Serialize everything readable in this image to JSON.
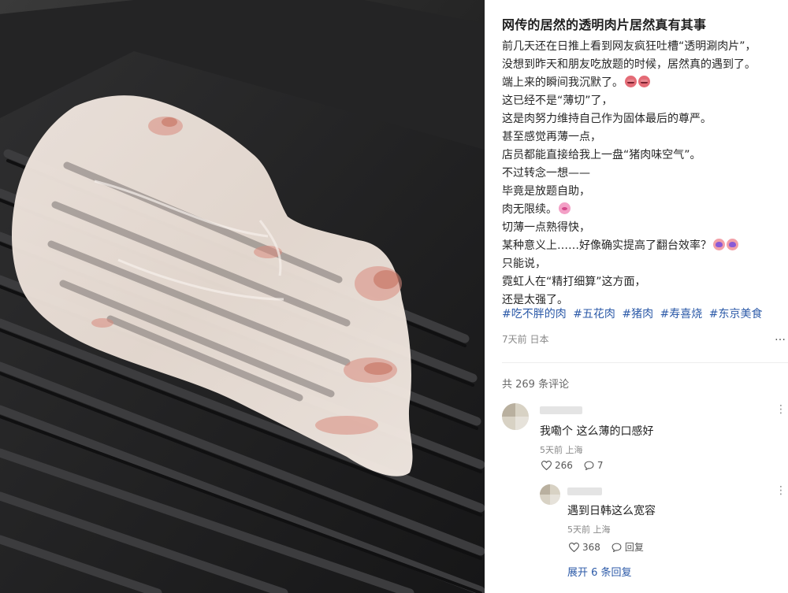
{
  "post": {
    "title": "网传的居然的透明肉片居然真有其事",
    "lines": [
      "前几天还在日推上看到网友疯狂吐槽“透明涮肉片”，",
      "没想到昨天和朋友吃放题的时候，居然真的遇到了。",
      "端上来的瞬间我沉默了。",
      "这已经不是“薄切”了，",
      "这是肉努力维持自己作为固体最后的尊严。",
      "甚至感觉再薄一点，",
      "店员都能直接给我上一盘“猪肉味空气”。",
      "不过转念一想——",
      "毕竟是放题自助，",
      "肉无限续。",
      "切薄一点熟得快，",
      "某种意义上……好像确实提高了翻台效率？",
      "只能说，",
      "霓虹人在“精打细算”这方面，",
      "还是太强了。"
    ],
    "tags": [
      "#吃不胖的肉",
      "#五花肉",
      "#猪肉",
      "#寿喜烧",
      "#东京美食"
    ],
    "meta": "7天前 日本",
    "more": "…"
  },
  "comments": {
    "count_label": "共 269 条评论",
    "first": {
      "text": "我嘞个 这么薄的口感好",
      "meta": "5天前 上海",
      "likes": "266",
      "replies": "7",
      "more": "⋮"
    },
    "reply": {
      "text": "遇到日韩这么宽容",
      "meta": "5天前 上海",
      "likes": "368",
      "reply_label": "回复",
      "more": "⋮"
    },
    "expand_label": "展开 6 条回复"
  },
  "icons": {
    "heart": "heart-icon",
    "comment": "comment-bubble-icon",
    "more": "more-dots-icon",
    "emoji_upset": "upset-face-emoji",
    "emoji_pig": "pig-face-emoji",
    "emoji_mind_blown": "mind-blown-emoji"
  },
  "colors": {
    "tag": "#2c5aa8",
    "meta": "#888888",
    "title": "#1f1f1f"
  }
}
